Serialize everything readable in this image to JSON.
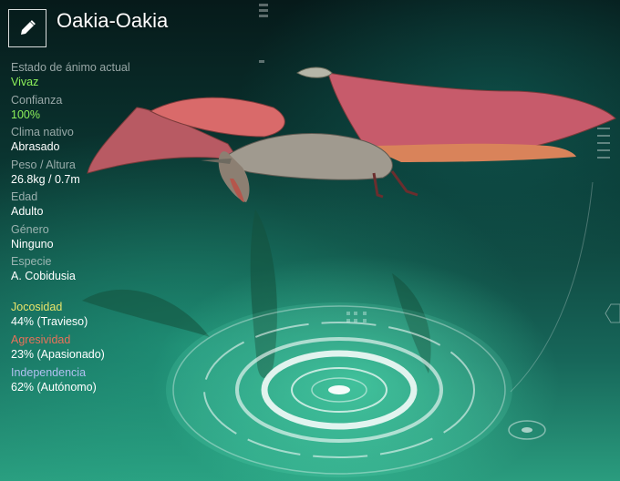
{
  "creature": {
    "name": "Oakia-Oakia"
  },
  "icons": {
    "edit": "pencil-icon"
  },
  "stats": [
    {
      "label": "Estado de ánimo actual",
      "value": "Vivaz",
      "value_color": "green"
    },
    {
      "label": "Confianza",
      "value": "100%",
      "value_color": "green"
    },
    {
      "label": "Clima nativo",
      "value": "Abrasado"
    },
    {
      "label": "Peso / Altura",
      "value": "26.8kg / 0.7m"
    },
    {
      "label": "Edad",
      "value": "Adulto"
    },
    {
      "label": "Género",
      "value": "Ninguno"
    },
    {
      "label": "Especie",
      "value": "A. Cobidusia"
    }
  ],
  "traits": [
    {
      "label": "Jocosidad",
      "value": "44% (Travieso)",
      "color": "#e8e46a"
    },
    {
      "label": "Agresividad",
      "value": "23% (Apasionado)",
      "color": "#e8725a"
    },
    {
      "label": "Independencia",
      "value": "62% (Autónomo)",
      "color": "#b0c0f0"
    }
  ]
}
